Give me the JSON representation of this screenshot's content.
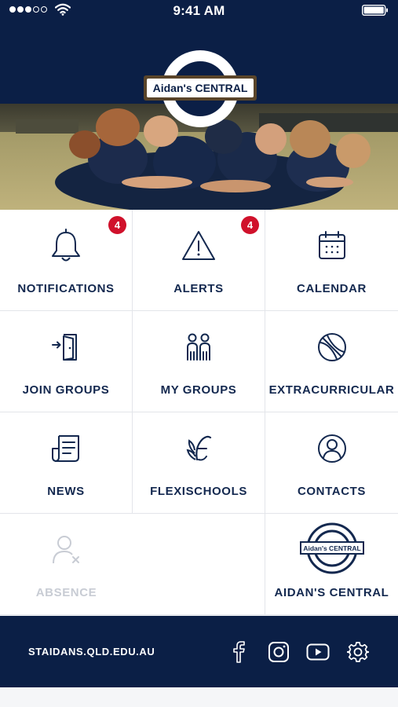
{
  "status_bar": {
    "time": "9:41 AM",
    "signal_bars": 3,
    "signal_total": 5
  },
  "brand": {
    "logo_text": "Aidan's CENTRAL",
    "navy": "#0b1f46",
    "badge_red": "#d0112b"
  },
  "tiles": [
    {
      "label": "NOTIFICATIONS",
      "icon": "bell-icon",
      "badge": "4"
    },
    {
      "label": "ALERTS",
      "icon": "warning-icon",
      "badge": "4"
    },
    {
      "label": "CALENDAR",
      "icon": "calendar-icon"
    },
    {
      "label": "JOIN GROUPS",
      "icon": "door-enter-icon"
    },
    {
      "label": "MY GROUPS",
      "icon": "people-icon"
    },
    {
      "label": "EXTRACURRICULAR",
      "icon": "basketball-icon"
    },
    {
      "label": "NEWS",
      "icon": "newspaper-icon"
    },
    {
      "label": "FLEXISCHOOLS",
      "icon": "flexischools-icon"
    },
    {
      "label": "CONTACTS",
      "icon": "user-circle-icon"
    },
    {
      "label": "ABSENCE",
      "icon": "user-remove-icon",
      "disabled": true
    },
    {
      "label": "AIDAN'S CENTRAL",
      "icon": "aidans-central-logo",
      "logo_text": "Aidan's CENTRAL"
    }
  ],
  "footer": {
    "website": "STAIDANS.QLD.EDU.AU",
    "social": [
      "facebook-icon",
      "instagram-icon",
      "youtube-icon",
      "gear-icon"
    ]
  }
}
